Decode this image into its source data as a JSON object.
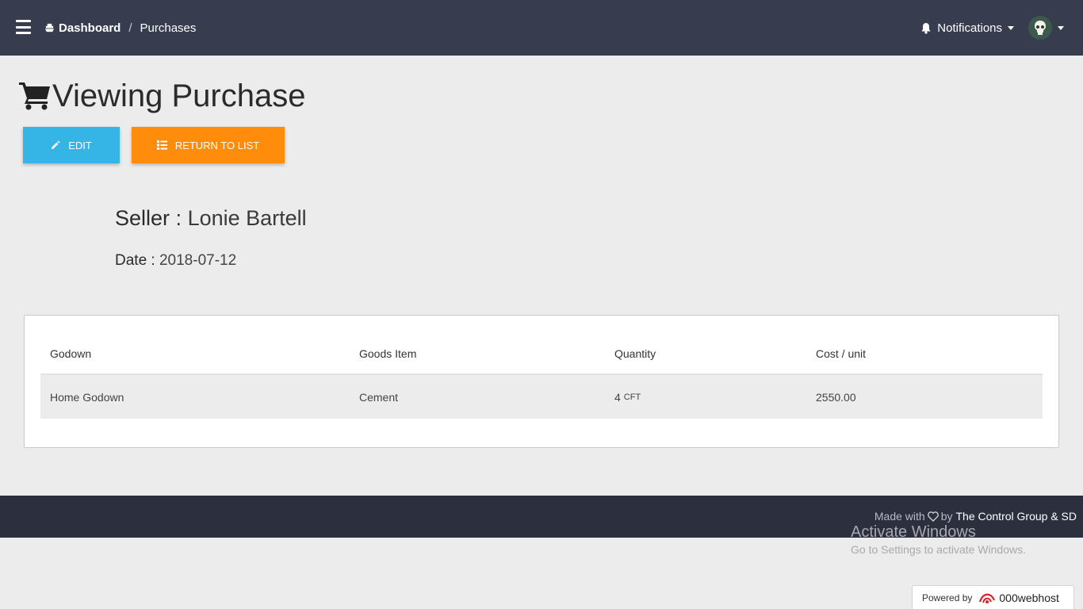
{
  "navbar": {
    "breadcrumb_home": "Dashboard",
    "breadcrumb_separator": "/",
    "breadcrumb_current": "Purchases",
    "notifications_label": "Notifications"
  },
  "page": {
    "title": "Viewing Purchase",
    "edit_label": "EDIT",
    "return_label": "RETURN TO LIST"
  },
  "purchase": {
    "seller_label": "Seller :",
    "seller_value": "Lonie Bartell",
    "date_label": "Date :",
    "date_value": "2018-07-12"
  },
  "table": {
    "headers": [
      "Godown",
      "Goods Item",
      "Quantity",
      "Cost / unit"
    ],
    "rows": [
      {
        "godown": "Home Godown",
        "item": "Cement",
        "quantity": "4",
        "unit": "CFT",
        "cost": "2550.00"
      }
    ]
  },
  "footer": {
    "made_with": "Made with",
    "by": "by",
    "org": "The Control Group & SD"
  },
  "watermark": {
    "line1": "Activate Windows",
    "line2": "Go to Settings to activate Windows."
  },
  "powered": {
    "label": "Powered by",
    "brand": "000webhost"
  },
  "colors": {
    "navbar": "#373c4e",
    "footer": "#2b2f3e",
    "edit_button": "#34b5e5",
    "return_button": "#ff8c0a"
  },
  "icons": {
    "menu": "hamburger-icon",
    "home": "ship-icon",
    "notifications": "bell-icon",
    "avatar": "skull-avatar",
    "title": "shopping-cart-icon",
    "edit": "pencil-icon",
    "return": "list-icon",
    "footer": "heart-icon"
  }
}
